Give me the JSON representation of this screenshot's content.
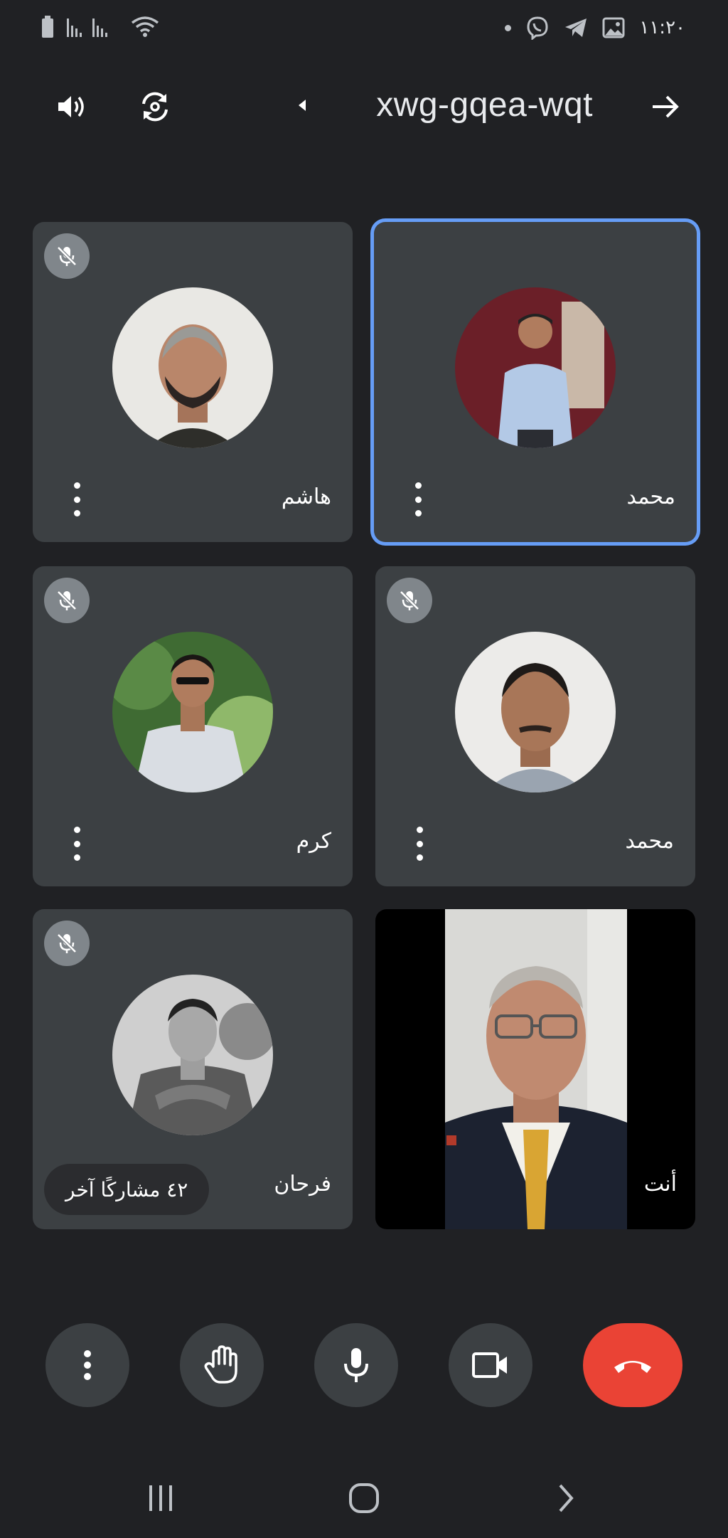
{
  "status_bar": {
    "time": "١١:٢٠"
  },
  "top_bar": {
    "meeting_code": "xwg-gqea-wqt"
  },
  "participants": [
    {
      "name": "محمد",
      "muted": false,
      "active_speaker": true
    },
    {
      "name": "هاشم",
      "muted": true,
      "active_speaker": false
    },
    {
      "name": "محمد",
      "muted": true,
      "active_speaker": false
    },
    {
      "name": "كرم",
      "muted": true,
      "active_speaker": false
    },
    {
      "name": "أنت",
      "muted": false,
      "self_view": true
    },
    {
      "name": "فرحان",
      "muted": true,
      "active_speaker": false
    }
  ],
  "others_chip": {
    "label": "٤٢ مشاركًا آخر"
  },
  "colors": {
    "background": "#202124",
    "tile": "#3c4043",
    "active_border": "#669df6",
    "end_call": "#ea4335"
  },
  "icons": [
    "battery-icon",
    "signal-icon",
    "wifi-icon",
    "viber-icon",
    "telegram-icon",
    "gallery-icon",
    "speaker-icon",
    "switch-camera-icon",
    "arrow-right-icon",
    "mic-off-icon",
    "more-vert-icon",
    "raise-hand-icon",
    "mic-icon",
    "camera-icon",
    "end-call-icon",
    "recents-icon",
    "home-icon",
    "back-icon"
  ]
}
